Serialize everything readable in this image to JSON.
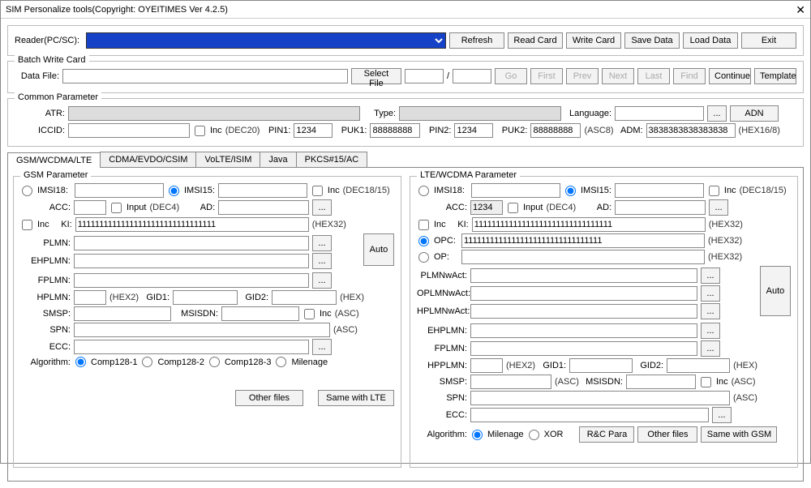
{
  "window": {
    "title": "SIM Personalize tools(Copyright: OYEITIMES Ver 4.2.5)"
  },
  "reader": {
    "label": "Reader(PC/SC):",
    "refresh": "Refresh",
    "read": "Read Card",
    "write": "Write Card",
    "save": "Save Data",
    "load": "Load Data",
    "exit": "Exit"
  },
  "batch": {
    "legend": "Batch Write Card",
    "datafile_label": "Data File:",
    "selectfile": "Select File",
    "slash": "/",
    "go": "Go",
    "first": "First",
    "prev": "Prev",
    "next": "Next",
    "last": "Last",
    "find": "Find",
    "continue": "Continue",
    "template": "Template"
  },
  "common": {
    "legend": "Common Parameter",
    "atr": "ATR:",
    "type": "Type:",
    "language": "Language:",
    "lang_btn": "...",
    "adn": "ADN",
    "iccid": "ICCID:",
    "inc": "Inc",
    "dec20": "(DEC20)",
    "pin1l": "PIN1:",
    "pin1": "1234",
    "puk1l": "PUK1:",
    "puk1": "88888888",
    "pin2l": "PIN2:",
    "pin2": "1234",
    "puk2l": "PUK2:",
    "puk2": "88888888",
    "asc8": "(ASC8)",
    "adml": "ADM:",
    "adm": "3838383838383838",
    "hex168": "(HEX16/8)"
  },
  "tabs": {
    "t0": "GSM/WCDMA/LTE",
    "t1": "CDMA/EVDO/CSIM",
    "t2": "VoLTE/ISIM",
    "t3": "Java",
    "t4": "PKCS#15/AC"
  },
  "gsm": {
    "legend": "GSM Parameter",
    "imsi18": "IMSI18:",
    "imsi15": "IMSI15:",
    "inc": "Inc",
    "decfmt": "(DEC18/15)",
    "acc": "ACC:",
    "input": "Input",
    "dec4": "(DEC4)",
    "ad": "AD:",
    "dots": "...",
    "ki": "KI:",
    "ki_val": "11111111111111111111111111111111",
    "hex32": "(HEX32)",
    "plmn": "PLMN:",
    "ehplmn": "EHPLMN:",
    "fplmn": "FPLMN:",
    "auto": "Auto",
    "hplmn": "HPLMN:",
    "hex2": "(HEX2)",
    "gid1": "GID1:",
    "gid2": "GID2:",
    "hex": "(HEX)",
    "smsp": "SMSP:",
    "msisdn": "MSISDN:",
    "asc": "(ASC)",
    "spn": "SPN:",
    "ecc": "ECC:",
    "algo": "Algorithm:",
    "a1": "Comp128-1",
    "a2": "Comp128-2",
    "a3": "Comp128-3",
    "a4": "Milenage",
    "other": "Other files",
    "same": "Same with LTE"
  },
  "lte": {
    "legend": "LTE/WCDMA Parameter",
    "imsi18": "IMSI18:",
    "imsi15": "IMSI15:",
    "inc": "Inc",
    "decfmt": "(DEC18/15)",
    "acc": "ACC:",
    "acc_val": "1234",
    "input": "Input",
    "dec4": "(DEC4)",
    "ad": "AD:",
    "dots": "...",
    "ki": "KI:",
    "ki_val": "11111111111111111111111111111111",
    "hex32": "(HEX32)",
    "opc": "OPC:",
    "opc_val": "11111111111111111111111111111111",
    "op": "OP:",
    "plmnwact": "PLMNwAct:",
    "oplmnwact": "OPLMNwAct:",
    "hplmnwact": "HPLMNwAct:",
    "ehplmn": "EHPLMN:",
    "fplmn": "FPLMN:",
    "hpplmn": "HPPLMN:",
    "hex2": "(HEX2)",
    "gid1": "GID1:",
    "gid2": "GID2:",
    "hex": "(HEX)",
    "smsp": "SMSP:",
    "asc": "(ASC)",
    "msisdn": "MSISDN:",
    "spn": "SPN:",
    "ecc": "ECC:",
    "auto": "Auto",
    "algo": "Algorithm:",
    "a1": "Milenage",
    "a2": "XOR",
    "rc": "R&C Para",
    "other": "Other files",
    "same": "Same with GSM"
  }
}
